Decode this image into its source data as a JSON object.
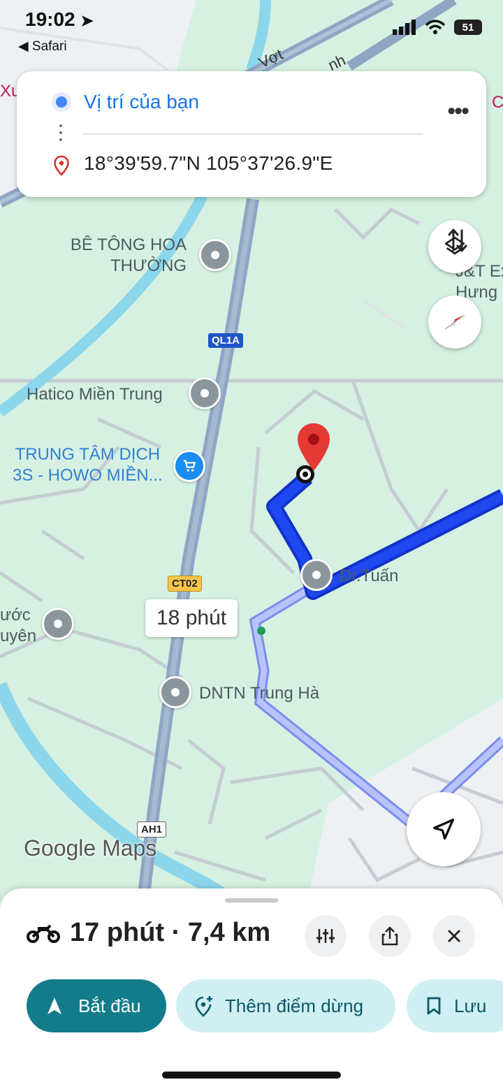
{
  "status_bar": {
    "time": "19:02",
    "back_app": "Safari",
    "battery": "51"
  },
  "directions": {
    "origin": "Vị trí của bạn",
    "destination": "18°39'59.7\"N 105°37'26.9\"E"
  },
  "map": {
    "route_chip": "18 phút",
    "shields": {
      "ql1a": "QL1A",
      "ct02": "CT02",
      "ah1": "AH1"
    },
    "roads_text": {
      "top1": "Vợt",
      "top2": "nh",
      "left_edge": "Xu",
      "right_edge": "C"
    },
    "places": {
      "be_tong_line1": "BÊ TÔNG HOA",
      "be_tong_line2": "THƯỜNG",
      "hatico": "Hatico Miền Trung",
      "trung_tam_line1": "TRUNG TÂM DỊCH",
      "trung_tam_line2": "3S - HOWO MIỀN...",
      "dr_tuan": "Dr.Tuấn",
      "dntn": "DNTN Trung Hà",
      "left_cut_line1": "ước",
      "left_cut_line2": "uyên",
      "jt_line1": "J&T Ex",
      "jt_line2": "Hưng"
    },
    "logo": "Google Maps",
    "colors": {
      "route_main": "#1a3fe0",
      "route_alt": "#a9b7f5",
      "river": "#7fd0e8",
      "highway": "#8ea6c4",
      "pin": "#e53935"
    }
  },
  "sheet": {
    "trip_summary": "17 phút · 7,4 km",
    "mode_icon": "motorcycle-icon",
    "start_label": "Bắt đầu",
    "add_stop_label": "Thêm điểm dừng",
    "save_label": "Lưu",
    "accent": "#137c8b"
  }
}
